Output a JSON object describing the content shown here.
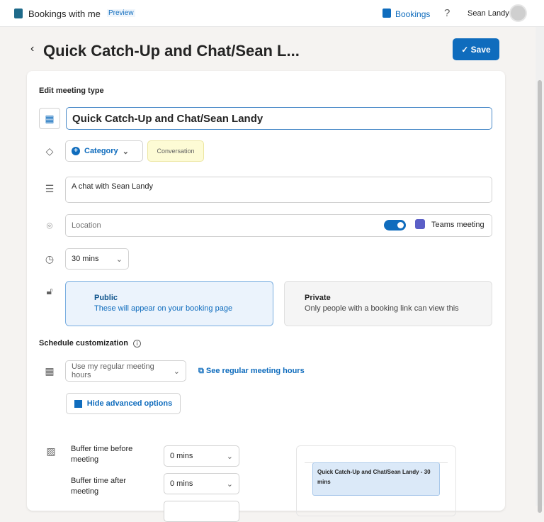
{
  "header": {
    "app_title": "Bookings with me",
    "preview_badge": "Preview",
    "bookings_link": "Bookings",
    "help": "?",
    "user_name": "Sean Landy"
  },
  "page": {
    "title": "Quick Catch-Up and Chat/Sean L...",
    "save_label": "Save"
  },
  "form": {
    "section_title": "Edit meeting type",
    "title_value": "Quick Catch-Up and Chat/Sean Landy",
    "category_label": "Category",
    "category_tag": "Conversation",
    "description_value": "A chat with Sean Landy",
    "location_placeholder": "Location",
    "teams_toggle_on": true,
    "teams_label": "Teams meeting",
    "duration_value": "30 mins",
    "public_title": "Public",
    "public_desc": "These will appear on your booking page",
    "private_title": "Private",
    "private_desc": "Only people with a booking link can view this",
    "visibility_selected": "Public"
  },
  "schedule": {
    "section_title": "Schedule customization",
    "hours_value": "Use my regular meeting hours",
    "see_hours_link": "See regular meeting hours",
    "advanced_button": "Hide advanced options",
    "buffer_before_label": "Buffer time before meeting",
    "buffer_before_value": "0 mins",
    "buffer_after_label": "Buffer time after meeting",
    "buffer_after_value": "0 mins",
    "preview_event": "Quick Catch-Up and Chat/Sean Landy - 30 mins"
  },
  "colors": {
    "accent": "#0f6cbd",
    "tag_bg": "#fdfbd5",
    "preview_bg": "#dbe9f8"
  }
}
